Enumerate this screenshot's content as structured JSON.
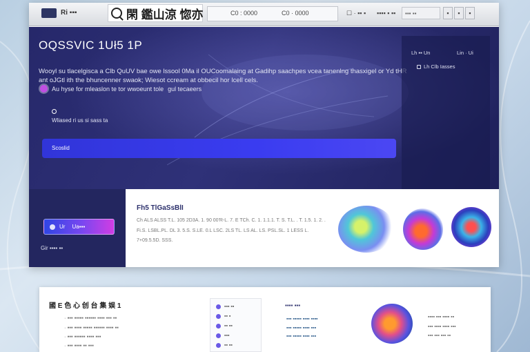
{
  "colors": {
    "hero_bg": "#2a2c72",
    "accent_bar": "#3a3cf0",
    "cta_start": "#2f46e4",
    "cta_end": "#d13de3",
    "bullet": "#c04fe3"
  },
  "toolbar": {
    "logo_text": "Ri ▪▪▪",
    "app_title": "閑 鑑山涼 惚亦",
    "address_a": "C0 : 0000",
    "address_b": "C0 · 0000",
    "link_a": "☐ · ▪▪ ▪",
    "link_b": "▪▪▪▪ ▪ ▪▪",
    "search_value": "▪▪▪ ▪▪",
    "btn_a": "▪",
    "btn_b": "▪",
    "btn_c": "▪"
  },
  "hero": {
    "title": "OQSSVIC 1Uł5 1P",
    "desc": "Wooyl su tlacelgisca a Clb QuUV bae owe lssool 0Ma il OUCoomalaing at Gadihp saachpes vcea tanenlng thasxigel or Yd tHR ant oJGtl ith the bhuncenner swaok; Wiesot ccream at obbecil hor lcell cels.",
    "bullet_text": "Au hyse for mleaslon te tor wwoeunt tole",
    "bullet_text_tail": "gul tecaeers",
    "meta": "Wliased ri us si sass ta",
    "side_a": "Lh  ▪▪ Un",
    "side_b": "Lin · Ui",
    "side_c": "Lh  Clb Iasses",
    "bar_label": "Scoslid"
  },
  "panel": {
    "cta_a": "Ur",
    "cta_b": "Ua▪▪▪",
    "caption": "Gir ▪▪▪▪ ▪▪"
  },
  "content": {
    "title": "Fh5 TlGaSsBlI",
    "line1": "Ch ALS ALSS T.L. 105 2D3A. 1. 90 00'R-L. 7. E TCh. C. 1. 1.1.1. T. S. T.L. . T. 1.5. 1. 2. .",
    "line2": "Fi.S. LSBL.PL. DL 3. 5.S. S.LE. 0.L LSC. 2LS TL. LS AL. LS. PSL.SL. 1 LESS L.",
    "line3": "7+09.5.5D. SSS."
  },
  "card": {
    "title": "國 E 色 心 创 台 集 娱   1",
    "line1": "· ▪▪▪ ▪▪▪▪▪ ▪▪▪▪▪▪ ▪▪▪▪ ▪▪▪ ▪▪",
    "line2": "· ▪▪▪ ▪▪▪▪ ▪▪▪▪▪ ▪▪▪▪▪▪ ▪▪▪▪ ▪▪",
    "line3": "· ▪▪▪ ▪▪▪▪▪▪ ▪▪▪▪ ▪▪▪",
    "line4": "· ▪▪▪ ▪▪▪▪ ▪▪ ▪▪▪",
    "list": [
      "▪▪▪ ▪▪",
      "▪▪ ▪",
      "▪▪ ▪▪",
      "▪▪▪",
      "▪▪ ▪▪"
    ],
    "feature_title": "▪▪▪▪ ▪▪▪",
    "feature1": "▪▪▪ ▪▪▪▪▪ ▪▪▪▪ ▪▪▪▪",
    "feature2": "▪▪▪ ▪▪▪▪▪ ▪▪▪▪ ▪▪▪",
    "feature3": "▪▪▪ ▪▪▪▪▪ ▪▪▪▪ ▪▪▪",
    "side1": "▪▪▪▪ ▪▪▪ ▪▪▪▪ ▪▪",
    "side2": "▪▪▪ ▪▪▪▪ ▪▪▪▪ ▪▪▪",
    "side3": "▪▪▪ ▪▪▪ ▪▪▪ ▪▪"
  }
}
